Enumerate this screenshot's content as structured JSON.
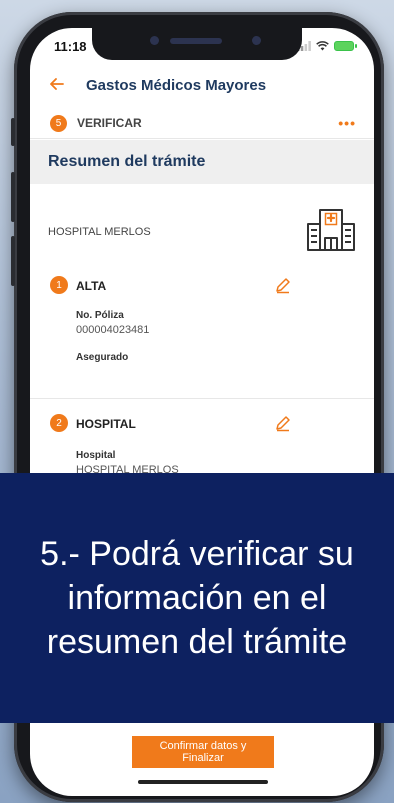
{
  "status_bar": {
    "time": "11:18"
  },
  "nav": {
    "back_icon": "arrow-left-icon",
    "title": "Gastos Médicos Mayores"
  },
  "step": {
    "number": "5",
    "label": "VERIFICAR",
    "menu": "•••"
  },
  "summary": {
    "title": "Resumen del trámite"
  },
  "hospital": {
    "name": "HOSPITAL MERLOS",
    "icon": "hospital-icon"
  },
  "sections": [
    {
      "number": "1",
      "title": "ALTA",
      "fields": [
        {
          "label": "No. Póliza",
          "value": "000004023481"
        },
        {
          "label": "Asegurado",
          "value": ""
        }
      ]
    },
    {
      "number": "2",
      "title": "HOSPITAL",
      "fields": [
        {
          "label": "Hospital",
          "value": "HOSPITAL MERLOS"
        }
      ]
    }
  ],
  "overlay": {
    "lines": [
      "5.- Podrá verificar su",
      "información en el",
      "resumen del trámite"
    ]
  },
  "confirm_button": {
    "label": "Confirmar datos y Finalizar"
  },
  "colors": {
    "accent": "#f07a1b",
    "title": "#1f3a5f",
    "overlay": "#0d2160"
  }
}
